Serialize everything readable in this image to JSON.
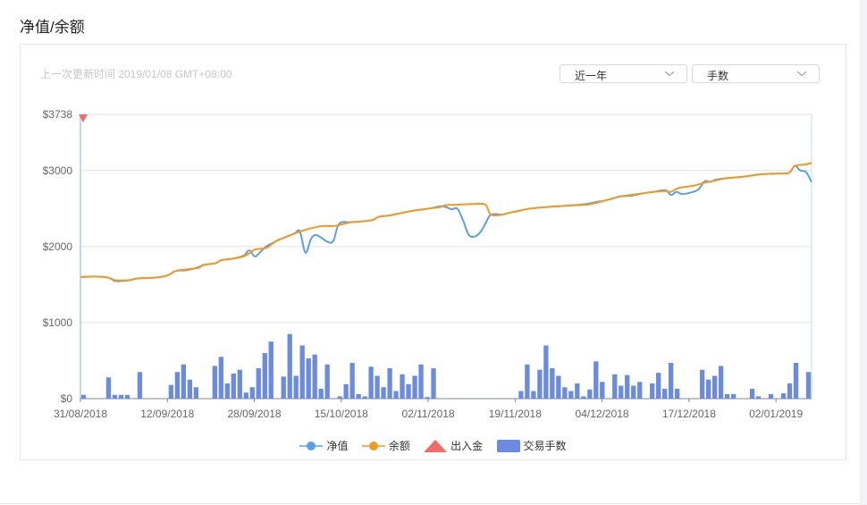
{
  "title": "净值/余额",
  "update_time": "上一次更新时间 2019/01/08 GMT+08:00",
  "range_select": {
    "value": "近一年"
  },
  "metric_select": {
    "value": "手数"
  },
  "colors": {
    "net_value": "#5aa0e6",
    "balance": "#f29a1f",
    "deposit": "#f26b6b",
    "lots": "#6b8be0",
    "axis": "#79b7e8",
    "grid": "#dde3ea"
  },
  "chart_data": {
    "type": "line",
    "x_ticks": [
      "31/08/2018",
      "12/09/2018",
      "28/09/2018",
      "15/10/2018",
      "02/11/2018",
      "19/11/2018",
      "04/12/2018",
      "17/12/2018",
      "02/01/2019"
    ],
    "x_range": [
      "2018-08-31",
      "2019-01-08"
    ],
    "y_ticks": [
      "$0",
      "$1000",
      "$2000",
      "$3000",
      "$3738"
    ],
    "ylim": [
      0,
      3738
    ],
    "legend": [
      "净值",
      "余额",
      "出入金",
      "交易手数"
    ],
    "legend_position": "bottom",
    "grid": true,
    "series": [
      {
        "name": "余额",
        "points": [
          [
            "2018-08-31",
            1600
          ],
          [
            "2018-09-03",
            1605
          ],
          [
            "2018-09-05",
            1590
          ],
          [
            "2018-09-06",
            1560
          ],
          [
            "2018-09-07",
            1555
          ],
          [
            "2018-09-09",
            1560
          ],
          [
            "2018-09-10",
            1580
          ],
          [
            "2018-09-13",
            1590
          ],
          [
            "2018-09-15",
            1610
          ],
          [
            "2018-09-16",
            1640
          ],
          [
            "2018-09-17",
            1680
          ],
          [
            "2018-09-19",
            1700
          ],
          [
            "2018-09-21",
            1720
          ],
          [
            "2018-09-22",
            1760
          ],
          [
            "2018-09-24",
            1780
          ],
          [
            "2018-09-25",
            1820
          ],
          [
            "2018-09-27",
            1840
          ],
          [
            "2018-09-29",
            1870
          ],
          [
            "2018-09-30",
            1910
          ],
          [
            "2018-10-01",
            1960
          ],
          [
            "2018-10-03",
            1980
          ],
          [
            "2018-10-04",
            2030
          ],
          [
            "2018-10-05",
            2080
          ],
          [
            "2018-10-06",
            2110
          ],
          [
            "2018-10-08",
            2170
          ],
          [
            "2018-10-10",
            2220
          ],
          [
            "2018-10-11",
            2240
          ],
          [
            "2018-10-13",
            2270
          ],
          [
            "2018-10-15",
            2270
          ],
          [
            "2018-10-17",
            2300
          ],
          [
            "2018-10-18",
            2320
          ],
          [
            "2018-10-20",
            2330
          ],
          [
            "2018-10-22",
            2350
          ],
          [
            "2018-10-23",
            2390
          ],
          [
            "2018-10-25",
            2410
          ],
          [
            "2018-10-27",
            2440
          ],
          [
            "2018-10-29",
            2470
          ],
          [
            "2018-11-01",
            2500
          ],
          [
            "2018-11-03",
            2520
          ],
          [
            "2018-11-04",
            2545
          ],
          [
            "2018-11-06",
            2550
          ],
          [
            "2018-11-09",
            2560
          ],
          [
            "2018-11-11",
            2550
          ],
          [
            "2018-11-12",
            2420
          ],
          [
            "2018-11-14",
            2420
          ],
          [
            "2018-11-15",
            2440
          ],
          [
            "2018-11-17",
            2470
          ],
          [
            "2018-11-19",
            2500
          ],
          [
            "2018-11-22",
            2520
          ],
          [
            "2018-11-24",
            2530
          ],
          [
            "2018-11-26",
            2540
          ],
          [
            "2018-11-29",
            2550
          ],
          [
            "2018-12-01",
            2580
          ],
          [
            "2018-12-02",
            2600
          ],
          [
            "2018-12-04",
            2640
          ],
          [
            "2018-12-05",
            2660
          ],
          [
            "2018-12-07",
            2680
          ],
          [
            "2018-12-09",
            2700
          ],
          [
            "2018-12-11",
            2720
          ],
          [
            "2018-12-13",
            2730
          ],
          [
            "2018-12-14",
            2720
          ],
          [
            "2018-12-15",
            2760
          ],
          [
            "2018-12-16",
            2780
          ],
          [
            "2018-12-18",
            2800
          ],
          [
            "2018-12-20",
            2840
          ],
          [
            "2018-12-22",
            2870
          ],
          [
            "2018-12-24",
            2900
          ],
          [
            "2018-12-27",
            2920
          ],
          [
            "2018-12-30",
            2950
          ],
          [
            "2019-01-02",
            2960
          ],
          [
            "2019-01-04",
            2970
          ],
          [
            "2019-01-05",
            3060
          ],
          [
            "2019-01-07",
            3080
          ],
          [
            "2019-01-08",
            3100
          ]
        ]
      },
      {
        "name": "净值",
        "points": [
          [
            "2018-08-31",
            1600
          ],
          [
            "2018-09-03",
            1605
          ],
          [
            "2018-09-05",
            1590
          ],
          [
            "2018-09-06",
            1550
          ],
          [
            "2018-09-07",
            1545
          ],
          [
            "2018-09-09",
            1560
          ],
          [
            "2018-09-10",
            1580
          ],
          [
            "2018-09-13",
            1590
          ],
          [
            "2018-09-15",
            1610
          ],
          [
            "2018-09-16",
            1640
          ],
          [
            "2018-09-17",
            1680
          ],
          [
            "2018-09-19",
            1690
          ],
          [
            "2018-09-21",
            1730
          ],
          [
            "2018-09-22",
            1760
          ],
          [
            "2018-09-24",
            1780
          ],
          [
            "2018-09-25",
            1820
          ],
          [
            "2018-09-27",
            1840
          ],
          [
            "2018-09-29",
            1880
          ],
          [
            "2018-09-30",
            1950
          ],
          [
            "2018-10-01",
            1870
          ],
          [
            "2018-10-02",
            1930
          ],
          [
            "2018-10-03",
            2000
          ],
          [
            "2018-10-04",
            2040
          ],
          [
            "2018-10-05",
            2080
          ],
          [
            "2018-10-06",
            2110
          ],
          [
            "2018-10-08",
            2170
          ],
          [
            "2018-10-09",
            2200
          ],
          [
            "2018-10-10",
            1920
          ],
          [
            "2018-10-11",
            2100
          ],
          [
            "2018-10-12",
            2150
          ],
          [
            "2018-10-14",
            2060
          ],
          [
            "2018-10-15",
            2080
          ],
          [
            "2018-10-16",
            2300
          ],
          [
            "2018-10-18",
            2320
          ],
          [
            "2018-10-20",
            2330
          ],
          [
            "2018-10-22",
            2350
          ],
          [
            "2018-10-23",
            2390
          ],
          [
            "2018-10-25",
            2410
          ],
          [
            "2018-10-27",
            2440
          ],
          [
            "2018-10-29",
            2470
          ],
          [
            "2018-11-01",
            2500
          ],
          [
            "2018-11-03",
            2530
          ],
          [
            "2018-11-04",
            2520
          ],
          [
            "2018-11-05",
            2490
          ],
          [
            "2018-11-06",
            2500
          ],
          [
            "2018-11-07",
            2350
          ],
          [
            "2018-11-08",
            2160
          ],
          [
            "2018-11-09",
            2130
          ],
          [
            "2018-11-10",
            2180
          ],
          [
            "2018-11-11",
            2300
          ],
          [
            "2018-11-12",
            2420
          ],
          [
            "2018-11-14",
            2420
          ],
          [
            "2018-11-15",
            2440
          ],
          [
            "2018-11-17",
            2470
          ],
          [
            "2018-11-19",
            2500
          ],
          [
            "2018-11-22",
            2520
          ],
          [
            "2018-11-24",
            2530
          ],
          [
            "2018-11-26",
            2540
          ],
          [
            "2018-11-29",
            2560
          ],
          [
            "2018-12-01",
            2590
          ],
          [
            "2018-12-02",
            2600
          ],
          [
            "2018-12-04",
            2640
          ],
          [
            "2018-12-05",
            2660
          ],
          [
            "2018-12-07",
            2670
          ],
          [
            "2018-12-09",
            2700
          ],
          [
            "2018-12-11",
            2720
          ],
          [
            "2018-12-13",
            2740
          ],
          [
            "2018-12-14",
            2680
          ],
          [
            "2018-12-15",
            2720
          ],
          [
            "2018-12-16",
            2690
          ],
          [
            "2018-12-18",
            2720
          ],
          [
            "2018-12-19",
            2760
          ],
          [
            "2018-12-20",
            2860
          ],
          [
            "2018-12-21",
            2850
          ],
          [
            "2018-12-22",
            2880
          ],
          [
            "2018-12-24",
            2900
          ],
          [
            "2018-12-27",
            2920
          ],
          [
            "2018-12-30",
            2950
          ],
          [
            "2019-01-02",
            2960
          ],
          [
            "2019-01-04",
            2970
          ],
          [
            "2019-01-05",
            3060
          ],
          [
            "2019-01-06",
            3000
          ],
          [
            "2019-01-07",
            2980
          ],
          [
            "2019-01-08",
            2850
          ]
        ]
      },
      {
        "name": "出入金",
        "points": [
          [
            "2018-08-31",
            3738
          ]
        ]
      },
      {
        "name": "交易手数",
        "bar_x_range": [
          "2018-08-31",
          "2019-01-08"
        ],
        "values": [
          50,
          0,
          0,
          0,
          280,
          50,
          50,
          50,
          0,
          350,
          0,
          0,
          0,
          0,
          180,
          350,
          450,
          250,
          150,
          0,
          0,
          430,
          550,
          200,
          330,
          380,
          80,
          150,
          400,
          600,
          750,
          0,
          290,
          850,
          300,
          700,
          530,
          580,
          130,
          450,
          0,
          30,
          190,
          470,
          60,
          30,
          420,
          300,
          150,
          400,
          100,
          320,
          190,
          300,
          450,
          20,
          400,
          0,
          0,
          0,
          0,
          0,
          0,
          0,
          0,
          0,
          0,
          0,
          0,
          0,
          100,
          450,
          100,
          380,
          700,
          400,
          300,
          150,
          100,
          200,
          30,
          120,
          490,
          220,
          0,
          320,
          170,
          310,
          170,
          220,
          0,
          200,
          340,
          130,
          470,
          130,
          0,
          0,
          0,
          380,
          250,
          300,
          430,
          60,
          60,
          0,
          0,
          130,
          30,
          0,
          60,
          0,
          70,
          200,
          470,
          0,
          350
        ]
      }
    ]
  }
}
